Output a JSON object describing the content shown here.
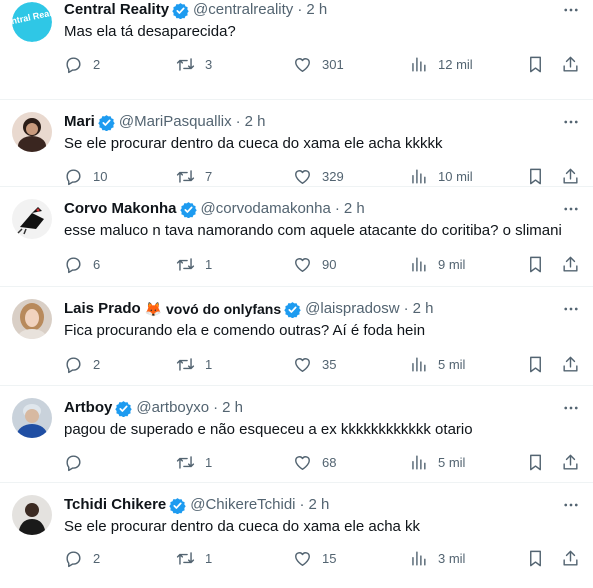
{
  "tweets": [
    {
      "name": "Central Reality",
      "badge": "",
      "handle": "@centralreality",
      "time": "2 h",
      "text": "Mas ela tá desaparecida?",
      "replies": "2",
      "retweets": "3",
      "likes": "301",
      "views": "12 mil",
      "avatar_label": "Central Reality"
    },
    {
      "name": "Mari",
      "badge": "",
      "handle": "@MariPasquallix",
      "time": "2 h",
      "text": "Se ele procurar dentro da cueca do xama ele acha kkkkk",
      "replies": "10",
      "retweets": "7",
      "likes": "329",
      "views": "10 mil"
    },
    {
      "name": "Corvo Makonha",
      "badge": "",
      "handle": "@corvodamakonha",
      "time": "2 h",
      "text": "esse maluco n tava namorando com aquele atacante do coritiba? o slimani",
      "replies": "6",
      "retweets": "1",
      "likes": "90",
      "views": "9 mil"
    },
    {
      "name": "Lais Prado",
      "badge": "🦊 vovó do onlyfans",
      "handle": "@laispradosw",
      "time": "2 h",
      "text": "Fica procurando ela e comendo outras? Aí é foda hein",
      "replies": "2",
      "retweets": "1",
      "likes": "35",
      "views": "5 mil"
    },
    {
      "name": "Artboy",
      "badge": "",
      "handle": "@artboyxo",
      "time": "2 h",
      "text": "pagou de superado e não esqueceu a ex kkkkkkkkkkkk otario",
      "replies": "",
      "retweets": "1",
      "likes": "68",
      "views": "5 mil"
    },
    {
      "name": "Tchidi Chikere",
      "badge": "",
      "handle": "@ChikereTchidi",
      "time": "2 h",
      "text": "Se ele procurar dentro da cueca do xama ele acha kk",
      "replies": "2",
      "retweets": "1",
      "likes": "15",
      "views": "3 mil"
    }
  ],
  "separator": "·",
  "colors": {
    "verified": "#1d9bf0",
    "secondary_text": "#536471",
    "primary_text": "#0f1419",
    "divider": "#eff3f4"
  }
}
